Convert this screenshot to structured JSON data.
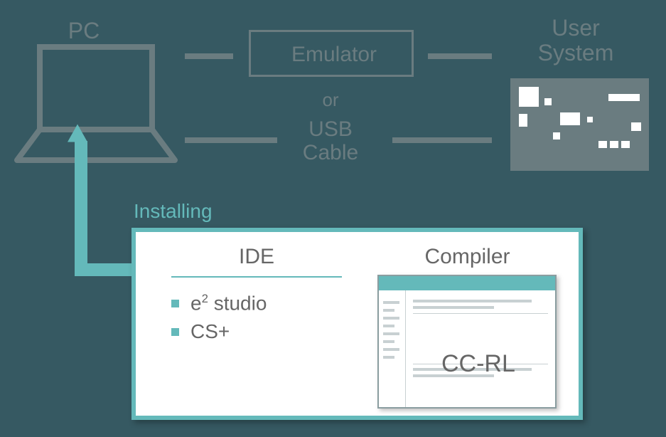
{
  "labels": {
    "pc": "PC",
    "emulator": "Emulator",
    "or": "or",
    "usb": "USB Cable",
    "userSystem": "User System",
    "installing": "Installing"
  },
  "install": {
    "ideTitle": "IDE",
    "compilerTitle": "Compiler",
    "ideItems": [
      "e² studio",
      "CS+"
    ],
    "compilerName": "CC-RL"
  }
}
